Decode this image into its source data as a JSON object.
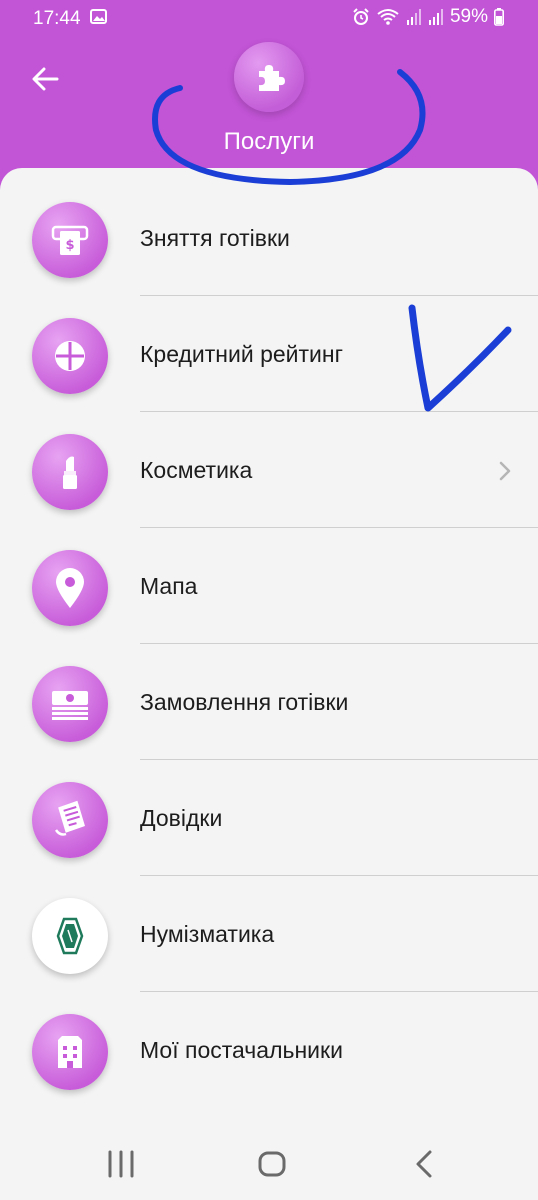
{
  "status_bar": {
    "time": "17:44",
    "battery": "59%"
  },
  "header": {
    "title": "Послуги"
  },
  "menu": [
    {
      "label": "Зняття готівки",
      "icon": "atm-cash-icon"
    },
    {
      "label": "Кредитний рейтинг",
      "icon": "credit-rating-icon"
    },
    {
      "label": "Косметика",
      "icon": "lipstick-icon",
      "chevron": true
    },
    {
      "label": "Мапа",
      "icon": "map-pin-icon"
    },
    {
      "label": "Замовлення готівки",
      "icon": "money-stack-icon"
    },
    {
      "label": "Довідки",
      "icon": "document-icon"
    },
    {
      "label": "Нумізматика",
      "icon": "banknote-icon"
    },
    {
      "label": "Мої постачальники",
      "icon": "building-icon"
    }
  ],
  "colors": {
    "header_bg": "#c254d6",
    "sheet_bg": "#f4f4f4",
    "annotation": "#1b3fd6",
    "banknote": "#1f7a5c"
  }
}
